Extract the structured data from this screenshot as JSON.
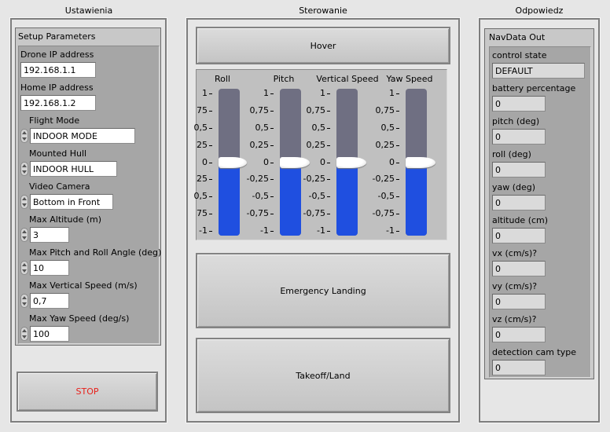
{
  "panels": {
    "settings_title": "Ustawienia",
    "control_title": "Sterowanie",
    "response_title": "Odpowiedz"
  },
  "setup": {
    "title": "Setup Parameters",
    "drone_ip_label": "Drone IP address",
    "drone_ip_value": "192.168.1.1",
    "home_ip_label": "Home IP address",
    "home_ip_value": "192.168.1.2",
    "flight_mode_label": "Flight Mode",
    "flight_mode_value": "INDOOR MODE",
    "hull_label": "Mounted Hull",
    "hull_value": "INDOOR HULL",
    "camera_label": "Video Camera",
    "camera_value": "Bottom in Front",
    "max_alt_label": "Max Altitude (m)",
    "max_alt_value": "3",
    "max_pitch_label": "Max Pitch and Roll Angle (deg)",
    "max_pitch_value": "10",
    "max_vs_label": "Max Vertical Speed (m/s)",
    "max_vs_value": "0,7",
    "max_yaw_label": "Max Yaw Speed (deg/s)",
    "max_yaw_value": "100"
  },
  "stop_label": "STOP",
  "stop_color": "#e8201a",
  "control": {
    "hover_label": "Hover",
    "emergency_label": "Emergency Landing",
    "takeoff_label": "Takeoff/Land",
    "sliders": [
      {
        "label": "Roll",
        "value": 0,
        "ticks": [
          "1",
          "75",
          "0,5",
          "25",
          "0",
          "25",
          "0,5",
          "75",
          "-1"
        ]
      },
      {
        "label": "Pitch",
        "value": 0,
        "ticks": [
          "1",
          "0,75",
          "0,5",
          "0,25",
          "0",
          "-0,25",
          "-0,5",
          "-0,75",
          "-1"
        ]
      },
      {
        "label": "Vertical Speed",
        "value": 0,
        "ticks": [
          "1",
          "0,75",
          "0,5",
          "0,25",
          "0",
          "-0,25",
          "-0,5",
          "-0,75",
          "-1"
        ]
      },
      {
        "label": "Yaw Speed",
        "value": 0,
        "ticks": [
          "1",
          "0,75",
          "0,5",
          "0,25",
          "0",
          "-0,25",
          "-0,5",
          "-0,75",
          "-1"
        ]
      }
    ],
    "slider_fill_color": "#1f4fe0"
  },
  "navdata": {
    "title": "NavData Out",
    "fields": [
      {
        "label": "control state",
        "value": "DEFAULT"
      },
      {
        "label": "battery percentage",
        "value": "0"
      },
      {
        "label": "pitch (deg)",
        "value": "0"
      },
      {
        "label": "roll (deg)",
        "value": "0"
      },
      {
        "label": "yaw (deg)",
        "value": "0"
      },
      {
        "label": "altitude (cm)",
        "value": "0"
      },
      {
        "label": "vx (cm/s)?",
        "value": "0"
      },
      {
        "label": "vy (cm/s)?",
        "value": "0"
      },
      {
        "label": "vz (cm/s)?",
        "value": "0"
      },
      {
        "label": "detection cam type",
        "value": "0"
      }
    ]
  }
}
